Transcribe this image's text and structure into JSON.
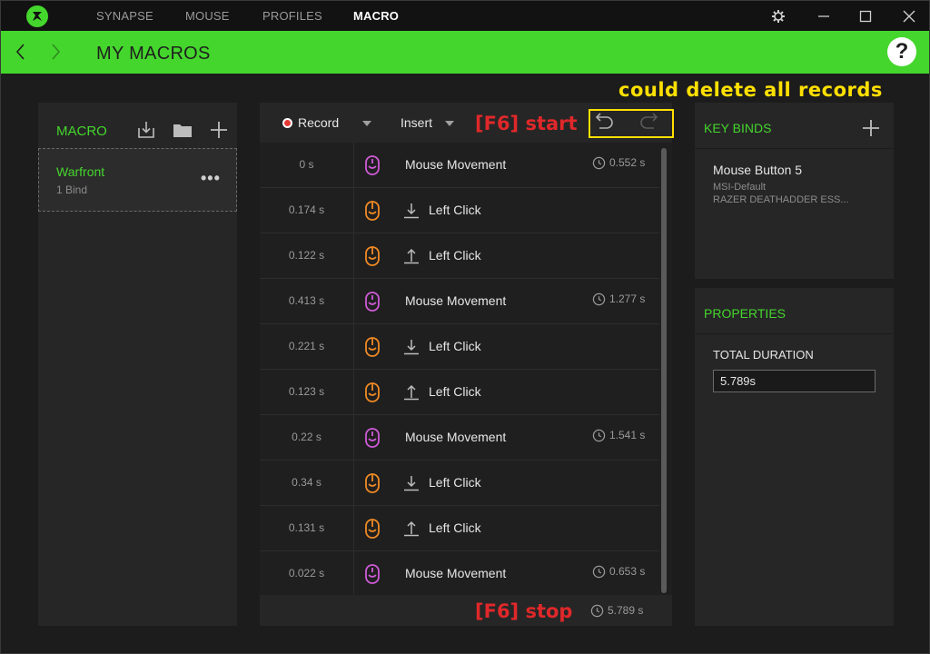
{
  "nav": {
    "tabs": [
      {
        "label": "SYNAPSE"
      },
      {
        "label": "MOUSE"
      },
      {
        "label": "PROFILES"
      },
      {
        "label": "MACRO"
      }
    ],
    "active": "MACRO"
  },
  "header": {
    "title": "MY MACROS",
    "help_label": "?"
  },
  "macro_panel": {
    "title": "MACRO",
    "item": {
      "name": "Warfront",
      "subtitle": "1 Bind",
      "more_label": "•••"
    }
  },
  "editor": {
    "record_label": "Record",
    "insert_label": "Insert",
    "rows": [
      {
        "delay": "0 s",
        "action": "Mouse Movement",
        "duration": "0.552 s",
        "type": "move"
      },
      {
        "delay": "0.174 s",
        "action": "Left Click",
        "duration": "",
        "type": "down"
      },
      {
        "delay": "0.122 s",
        "action": "Left Click",
        "duration": "",
        "type": "up"
      },
      {
        "delay": "0.413 s",
        "action": "Mouse Movement",
        "duration": "1.277 s",
        "type": "move"
      },
      {
        "delay": "0.221 s",
        "action": "Left Click",
        "duration": "",
        "type": "down"
      },
      {
        "delay": "0.123 s",
        "action": "Left Click",
        "duration": "",
        "type": "up"
      },
      {
        "delay": "0.22 s",
        "action": "Mouse Movement",
        "duration": "1.541 s",
        "type": "move"
      },
      {
        "delay": "0.34 s",
        "action": "Left Click",
        "duration": "",
        "type": "down"
      },
      {
        "delay": "0.131 s",
        "action": "Left Click",
        "duration": "",
        "type": "up"
      },
      {
        "delay": "0.022 s",
        "action": "Mouse Movement",
        "duration": "0.653 s",
        "type": "move"
      }
    ],
    "total": "5.789 s"
  },
  "keybinds": {
    "title": "KEY BINDS",
    "bind_name": "Mouse Button 5",
    "profile": "MSI-Default",
    "device": "RAZER DEATHADDER ESS..."
  },
  "properties": {
    "title": "PROPERTIES",
    "duration_label": "TOTAL DURATION",
    "duration_value": "5.789s"
  },
  "annotations": {
    "delete_note": "could delete all records",
    "start_note": "[F6] start",
    "stop_note": "[F6] stop"
  },
  "colors": {
    "accent": "#44d62c",
    "move_icon": "#d05ad8",
    "click_icon": "#f08a24",
    "annotation_yellow": "#ffe000",
    "annotation_red": "#e0282a"
  },
  "icons": {
    "move": "mouse-move-icon",
    "click": "mouse-click-icon",
    "down": "arrow-down-icon",
    "up": "arrow-up-icon",
    "timer": "clock-icon"
  }
}
